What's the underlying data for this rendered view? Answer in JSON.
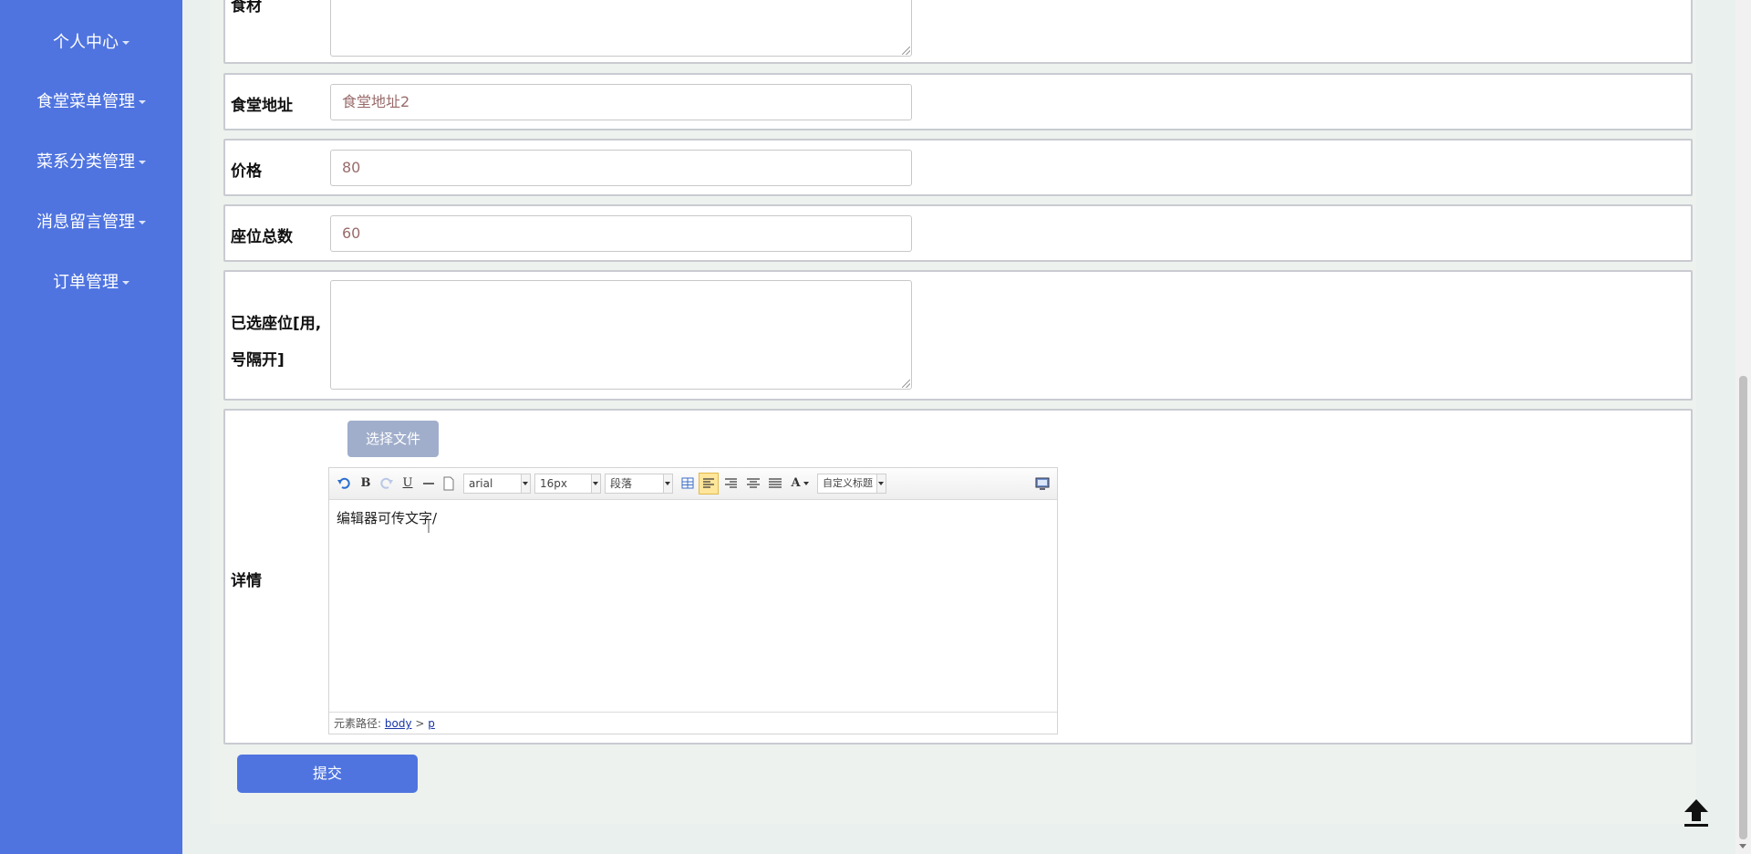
{
  "sidebar": {
    "items": [
      {
        "label": "个人中心"
      },
      {
        "label": "食堂菜单管理"
      },
      {
        "label": "菜系分类管理"
      },
      {
        "label": "消息留言管理"
      },
      {
        "label": "订单管理"
      }
    ]
  },
  "form": {
    "top_partial_label": "食材",
    "address": {
      "label": "食堂地址",
      "value": "食堂地址2"
    },
    "price": {
      "label": "价格",
      "value": "80"
    },
    "seats": {
      "label": "座位总数",
      "value": "60"
    },
    "selected_seats": {
      "label_line1": "已选座位[用,",
      "label_line2": "号隔开]",
      "value": ""
    },
    "details": {
      "label": "详情",
      "file_button": "选择文件",
      "editor": {
        "font_family": "arial",
        "font_size": "16px",
        "paragraph": "段落",
        "custom_title": "自定义标题",
        "bold": "B",
        "underline": "U",
        "font_color": "A",
        "content": "编辑器可传文字/",
        "path_label": "元素路径:",
        "path_body": "body",
        "path_sep": ">",
        "path_p": "p"
      }
    },
    "submit_label": "提交"
  },
  "colors": {
    "sidebar": "#4f74e0",
    "submit": "#4f74e0",
    "file_button": "#a0aecb",
    "page_bg": "#e9f0ee"
  },
  "icons": [
    "undo-icon",
    "redo-icon",
    "horizontal-rule-icon",
    "page-icon",
    "table-icon",
    "align-left-icon",
    "align-right-icon",
    "align-center-icon",
    "justify-icon",
    "fullscreen-icon",
    "back-to-top-icon"
  ]
}
